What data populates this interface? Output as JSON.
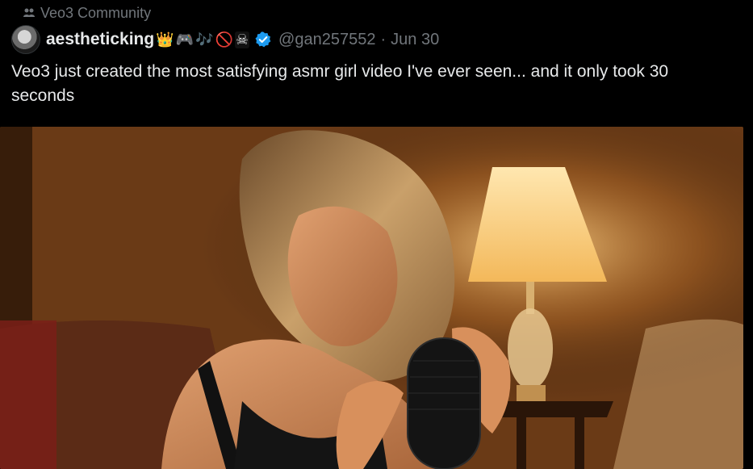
{
  "community": {
    "icon": "people-icon",
    "label": "Veo3 Community"
  },
  "author": {
    "display_name": "aestheticking",
    "emojis": [
      "👑",
      "🎮",
      "🎶",
      "🚫",
      "☠"
    ],
    "verified_icon": "verified-badge-icon",
    "handle": "@gan257552",
    "separator": "·",
    "date": "Jun 30"
  },
  "tweet": {
    "text": "Veo3 just created the most satisfying asmr girl video I've ever seen... and it only took 30 seconds"
  },
  "media": {
    "type": "video-still"
  },
  "colors": {
    "background": "#000000",
    "text": "#e7e9ea",
    "muted": "#71767b",
    "verified": "#1d9bf0"
  }
}
